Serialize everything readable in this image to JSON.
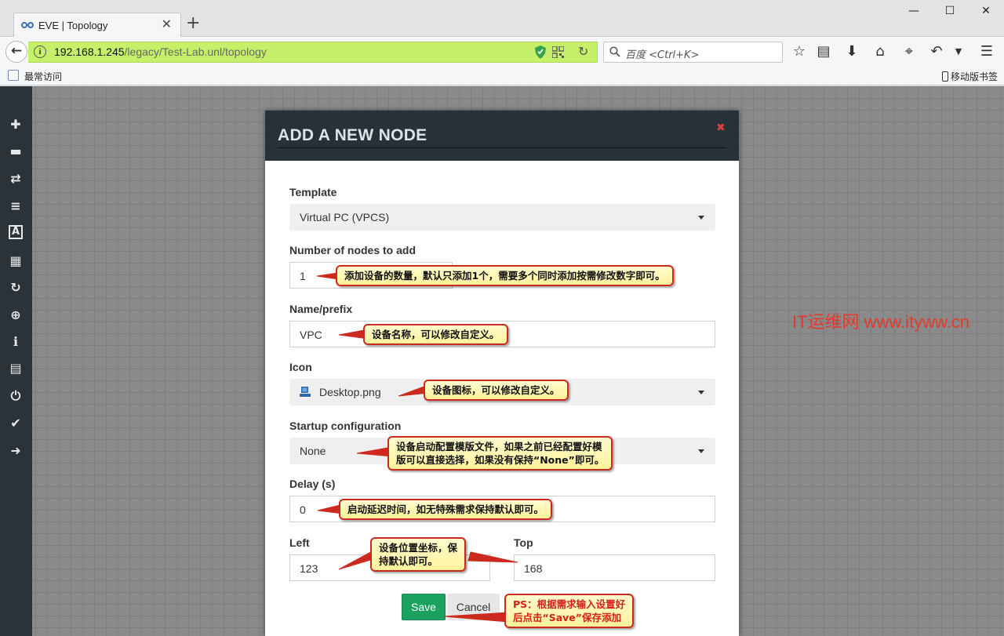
{
  "browser": {
    "tab_title": "EVE | Topology",
    "new_tab": "+",
    "tab_close": "✕",
    "url_host": "192.168.1.245",
    "url_path": "/legacy/Test-Lab.unl/topology",
    "search_placeholder": "百度 <Ctrl+K>",
    "bookmark_label": "最常访问",
    "mobile_bookmarks": "移动版书签",
    "window_controls": [
      "—",
      "☐",
      "✕"
    ]
  },
  "sidebar": {
    "items": [
      {
        "name": "add-icon",
        "glyph": "✚"
      },
      {
        "name": "nodes-icon",
        "glyph": "▬"
      },
      {
        "name": "networks-icon",
        "glyph": "⇄"
      },
      {
        "name": "startup-configs-icon",
        "glyph": "≡"
      },
      {
        "name": "text-icon",
        "glyph": "A"
      },
      {
        "name": "grid-icon",
        "glyph": "▦"
      },
      {
        "name": "refresh-icon",
        "glyph": "↻"
      },
      {
        "name": "zoom-icon",
        "glyph": "⊕"
      },
      {
        "name": "info-icon",
        "glyph": "ℹ"
      },
      {
        "name": "list-icon",
        "glyph": "▤"
      },
      {
        "name": "power-icon",
        "glyph": "⏻"
      },
      {
        "name": "check-icon",
        "glyph": "✔"
      },
      {
        "name": "logout-icon",
        "glyph": "➜"
      }
    ]
  },
  "watermark": "IT运维网 www.ityww.cn",
  "modal": {
    "title": "ADD A NEW NODE",
    "close": "✖",
    "template_label": "Template",
    "template_value": "Virtual PC (VPCS)",
    "count_label": "Number of nodes to add",
    "count_value": "1",
    "name_label": "Name/prefix",
    "name_value": "VPC",
    "icon_label": "Icon",
    "icon_value": "Desktop.png",
    "startup_label": "Startup configuration",
    "startup_value": "None",
    "delay_label": "Delay (s)",
    "delay_value": "0",
    "left_label": "Left",
    "left_value": "123",
    "top_label": "Top",
    "top_value": "168",
    "save_label": "Save",
    "cancel_label": "Cancel"
  },
  "callouts": {
    "count": "添加设备的数量，默认只添加1个，需要多个同时添加按需修改数字即可。",
    "name": "设备名称，可以修改自定义。",
    "icon": "设备图标，可以修改自定义。",
    "startup_line1": "设备启动配置模版文件，如果之前已经配置好模",
    "startup_line2": "版可以直接选择，如果没有保持“None”即可。",
    "delay": "启动延迟时间，如无特殊需求保持默认即可。",
    "position_line1": "设备位置坐标，保",
    "position_line2": "持默认即可。",
    "ps_line1": "PS：根据需求输入设置好",
    "ps_line2": "后点击“Save”保存添加"
  },
  "colors": {
    "url_bar": "#c7f06a",
    "sidebar": "#2b3338",
    "modal_header": "#263238",
    "save_button": "#1aa160",
    "callout_border": "#cc2a1e",
    "watermark": "#e23b2e"
  }
}
